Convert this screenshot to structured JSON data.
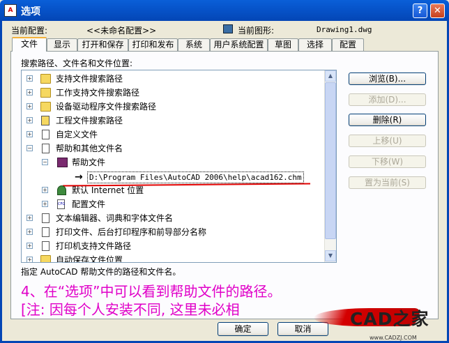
{
  "window": {
    "title": "选项",
    "help": "?",
    "close": "✕"
  },
  "header": {
    "current_profile_label": "当前配置:",
    "current_profile_value": "<<未命名配置>>",
    "current_drawing_label": "当前图形:",
    "current_drawing_value": "Drawing1.dwg"
  },
  "tabs": [
    "文件",
    "显示",
    "打开和保存",
    "打印和发布",
    "系统",
    "用户系统配置",
    "草图",
    "选择",
    "配置"
  ],
  "tree_label": "搜索路径、文件名和文件位置:",
  "tree": {
    "items": [
      "支持文件搜索路径",
      "工作支持文件搜索路径",
      "设备驱动程序文件搜索路径",
      "工程文件搜索路径",
      "自定义文件",
      "帮助和其他文件名",
      "帮助文件",
      "D:\\Program Files\\AutoCAD 2006\\help\\acad162.chm",
      "默认 Internet 位置",
      "配置文件",
      "文本编辑器、词典和字体文件名",
      "打印文件、后台打印程序和前导部分名称",
      "打印机支持文件路径",
      "自动保存文件位置"
    ]
  },
  "buttons": {
    "browse": "浏览(B)...",
    "add": "添加(D)...",
    "remove": "删除(R)",
    "move_up": "上移(U)",
    "move_down": "下移(W)",
    "set_current": "置为当前(S)"
  },
  "description": "指定 AutoCAD 帮助文件的路径和文件名。",
  "annotation": {
    "line1": "4、在“选项”中可以看到帮助文件的路径。",
    "line2": "[注: 因每个人安装不同, 这里未必相"
  },
  "footer": {
    "ok": "确定",
    "cancel": "取消"
  },
  "logo": {
    "text": "CAD之家",
    "url": "www.CADZJ.COM"
  },
  "colors": {
    "titlebar": "#0653c9",
    "annotation": "#e000c8",
    "underline": "#e00000"
  }
}
